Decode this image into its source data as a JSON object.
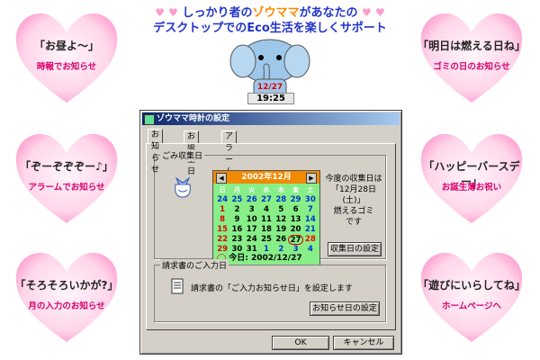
{
  "headline": {
    "hearts_left": "♥ ♥",
    "hearts_right": "♥ ♥",
    "line1_before": "しっかり者の",
    "line1_accent": "ゾウママ",
    "line1_after": "があなたの",
    "line2": "デスクトップでのEco生活を楽しくサポート"
  },
  "hearts": [
    {
      "title": "「お昼よ～」",
      "subtitle": "時報でお知らせ"
    },
    {
      "title": "「明日は燃える日ね」",
      "subtitle": "ゴミの日のお知らせ"
    },
    {
      "title": "「ぞーぞぞぞー♪」",
      "subtitle": "アラームでお知らせ"
    },
    {
      "title": "「ハッピーバースデー」",
      "subtitle": "お誕生薄お祝い"
    },
    {
      "title": "「そろそろいかが?」",
      "subtitle": "月の入力のお知らせ"
    },
    {
      "title": "「遊びにいらしてね」",
      "subtitle": "ホームページへ"
    }
  ],
  "clock": {
    "date": "12/27",
    "time": "19:25"
  },
  "window": {
    "title": "ゾウママ時計の設定",
    "tabs": [
      "お知らせ",
      "お誕生日",
      "アラーム"
    ],
    "garbage": {
      "group_label": "ごみ収集日",
      "info_line1": "今度の収集日は",
      "info_line2": "「12月28日(土)」",
      "info_line3": "燃えるゴミ",
      "info_line4": "です",
      "button": "収集日の設定"
    },
    "calendar": {
      "month_label": "2002年12月",
      "prev": "◀",
      "next": "▶",
      "weekdays": [
        "日",
        "月",
        "火",
        "水",
        "木",
        "金",
        "土"
      ],
      "weeks": [
        [
          "24",
          "25",
          "26",
          "27",
          "28",
          "29",
          "30"
        ],
        [
          "1",
          "2",
          "3",
          "4",
          "5",
          "6",
          "7"
        ],
        [
          "8",
          "9",
          "10",
          "11",
          "12",
          "13",
          "14"
        ],
        [
          "15",
          "16",
          "17",
          "18",
          "19",
          "20",
          "21"
        ],
        [
          "22",
          "23",
          "24",
          "25",
          "26",
          "27",
          "28"
        ],
        [
          "29",
          "30",
          "31",
          "1",
          "2",
          "3",
          "4"
        ]
      ],
      "today_label": "今日: 2002/12/27"
    },
    "invoice": {
      "group_label": "請求書のご入力日",
      "text": "請求書の「ご入力お知らせ日」を設定します",
      "button": "お知らせ日の設定"
    },
    "ok": "OK",
    "cancel": "キャンセル"
  },
  "colors": {
    "heart": "#ff99cc",
    "heart_inner": "#fff5fa",
    "calendar_bg": "#88ee88",
    "calendar_head": "#f08a00"
  }
}
